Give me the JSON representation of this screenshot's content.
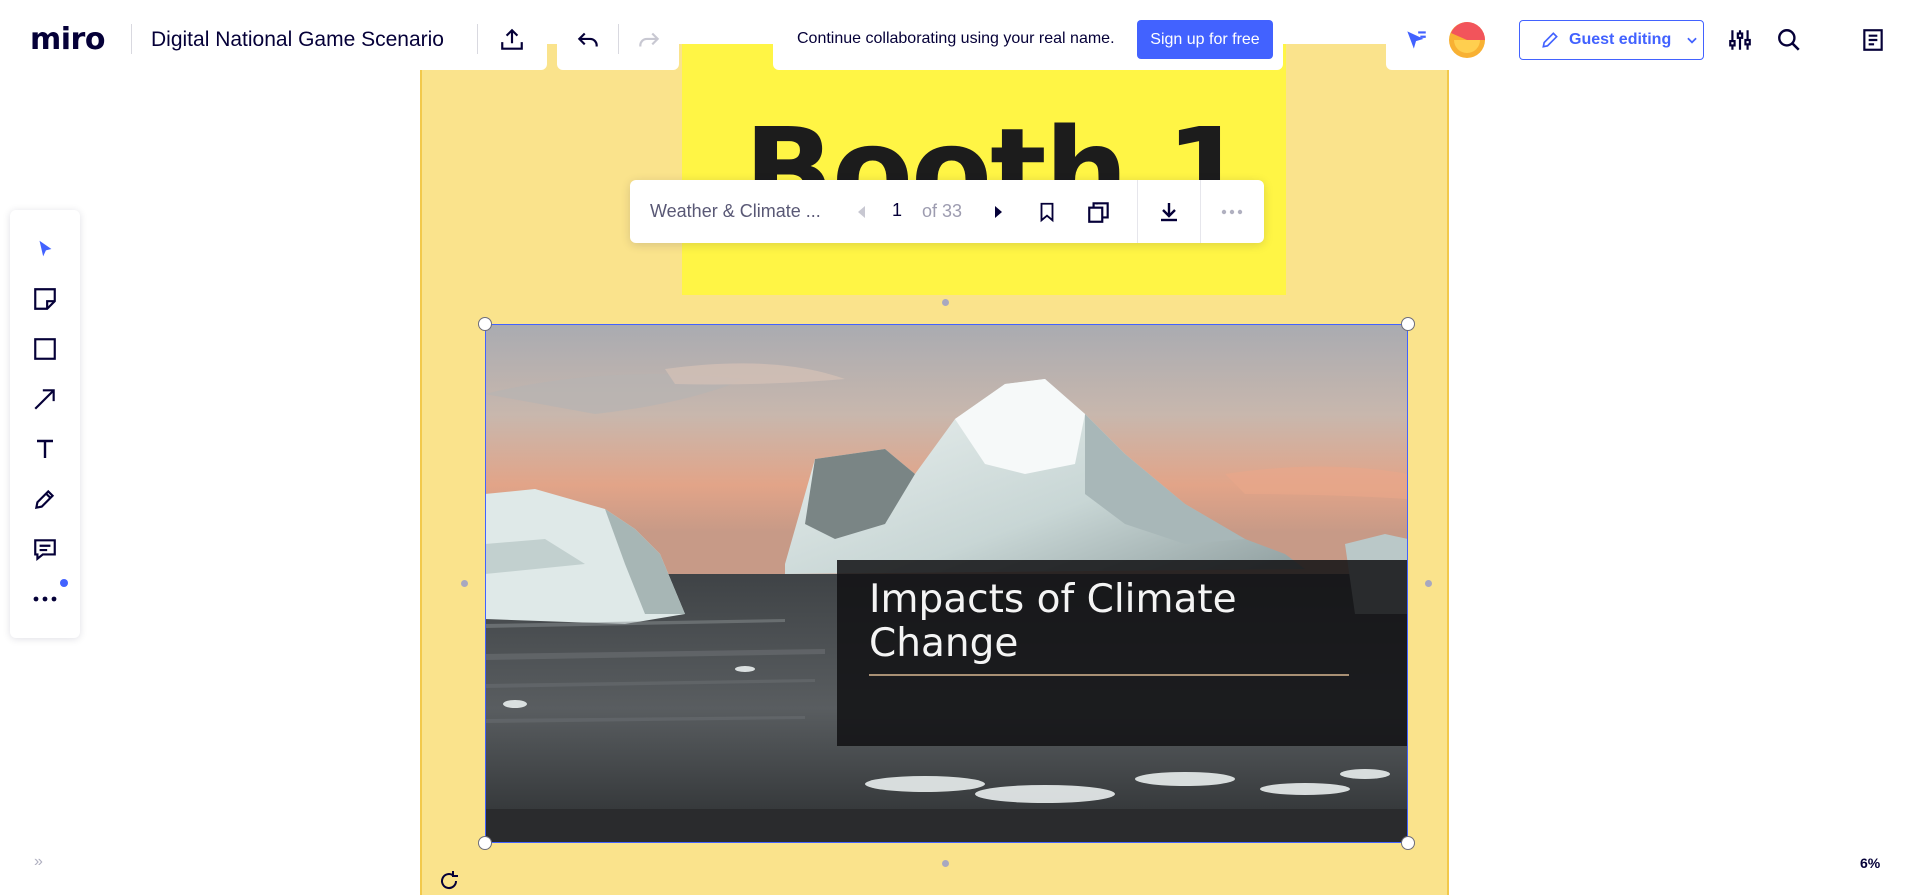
{
  "app": {
    "logo": "miro",
    "board_title": "Digital National Game Scenario"
  },
  "header": {
    "share_icon": "upload-icon",
    "undo_icon": "undo-icon",
    "redo_icon": "redo-icon",
    "collab_message": "Continue collaborating using your real name.",
    "signup_label": "Sign up for free",
    "reactions_icon": "cursor-reactions-icon",
    "guest_label": "Guest editing",
    "settings_icon": "sliders-icon",
    "search_icon": "search-icon",
    "notes_icon": "notes-icon"
  },
  "canvas": {
    "sticky_title": "Booth 1",
    "slide_caption": "Impacts of Climate Change",
    "frame_color": "#fae38c",
    "sticky_color": "#fff545"
  },
  "pdf_toolbar": {
    "document_name": "Weather & Climate ...",
    "current_page": "1",
    "of_pages": "of 33"
  },
  "left_toolbar": {
    "tools": [
      "select-tool",
      "sticky-note-tool",
      "shape-tool",
      "arrow-tool",
      "text-tool",
      "pen-tool",
      "comment-tool",
      "more-tools"
    ]
  },
  "footer": {
    "zoom": "6%"
  },
  "colors": {
    "accent": "#4262ff",
    "ink": "#050038"
  }
}
